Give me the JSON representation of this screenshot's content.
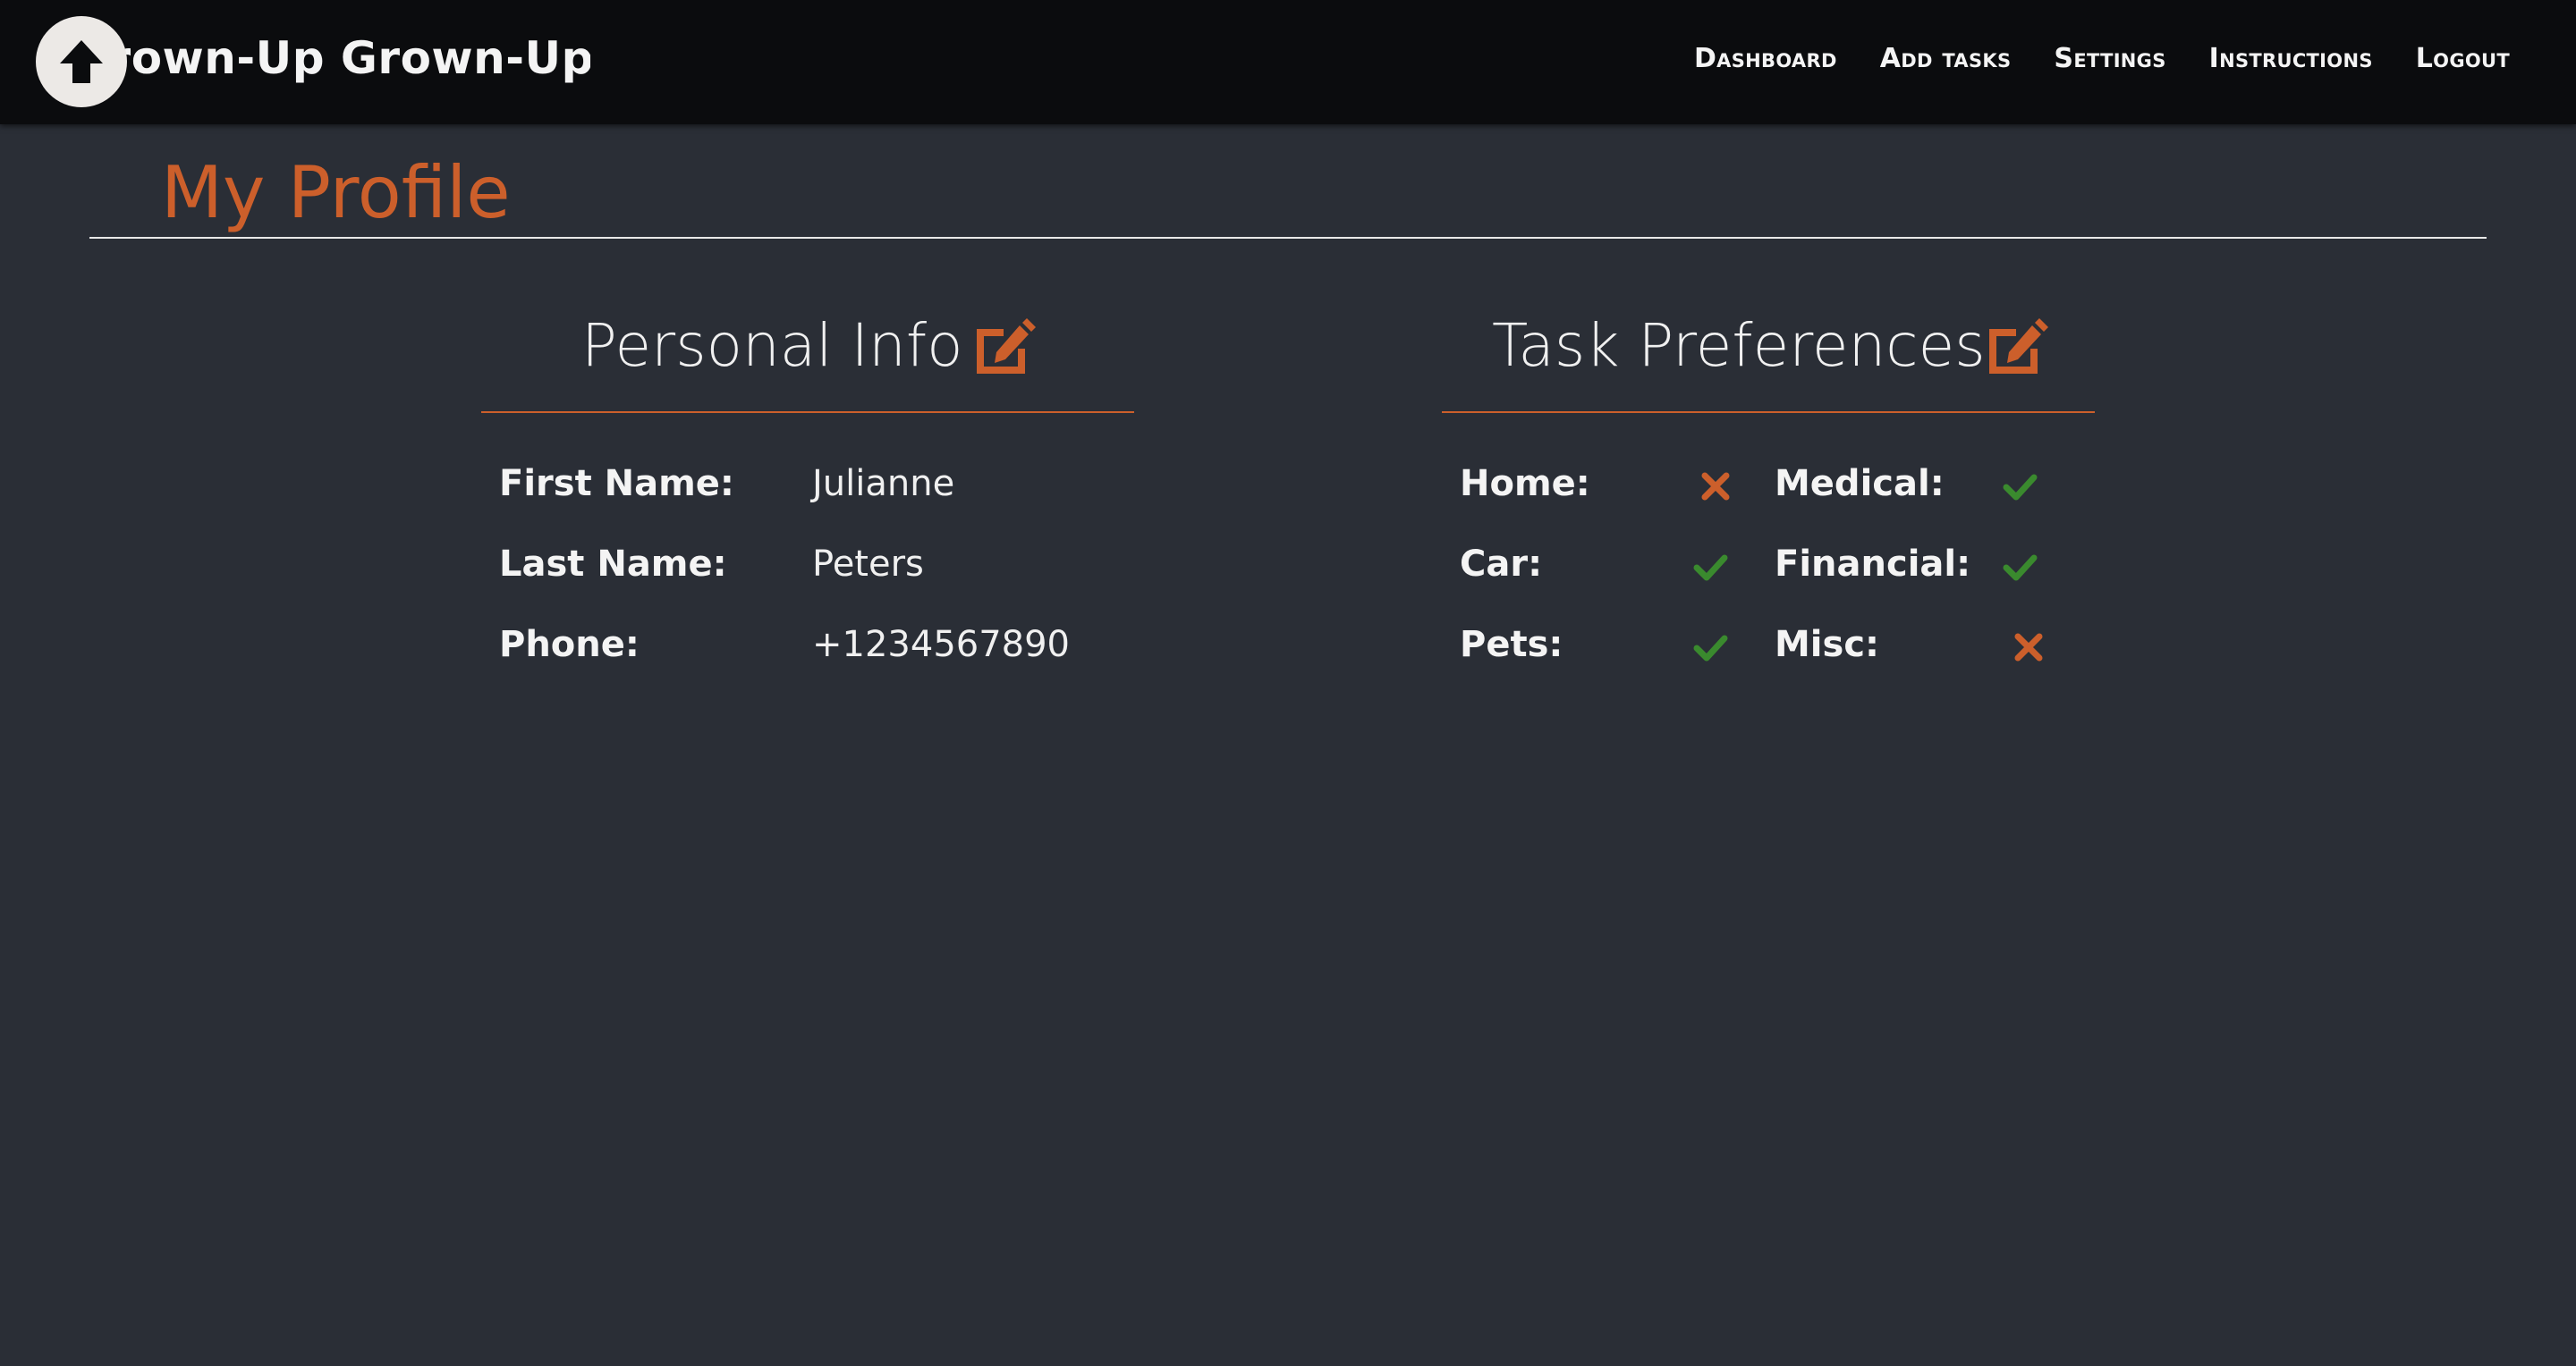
{
  "app": {
    "brand": "Grown-Up Grown-Up",
    "logo_icon": "arrow-up-icon"
  },
  "nav": {
    "items": [
      {
        "label": "Dashboard"
      },
      {
        "label": "Add tasks"
      },
      {
        "label": "Settings"
      },
      {
        "label": "Instructions"
      },
      {
        "label": "Logout"
      }
    ]
  },
  "page": {
    "title": "My Profile"
  },
  "personal_info": {
    "heading": "Personal Info",
    "edit_icon": "edit-icon",
    "rows": [
      {
        "label": "First Name:",
        "value": "Julianne"
      },
      {
        "label": "Last Name:",
        "value": "Peters"
      },
      {
        "label": "Phone:",
        "value": "+1234567890"
      }
    ]
  },
  "task_preferences": {
    "heading": "Task Preferences",
    "edit_icon": "edit-icon",
    "items": [
      {
        "label": "Home:",
        "enabled": false
      },
      {
        "label": "Medical:",
        "enabled": true
      },
      {
        "label": "Car:",
        "enabled": true
      },
      {
        "label": "Financial:",
        "enabled": true
      },
      {
        "label": "Pets:",
        "enabled": true
      },
      {
        "label": "Misc:",
        "enabled": false
      }
    ]
  },
  "colors": {
    "accent": "#cc5f2b",
    "check": "#3a8a2e",
    "background": "#2a2e36",
    "navbar": "#0b0c0e"
  }
}
